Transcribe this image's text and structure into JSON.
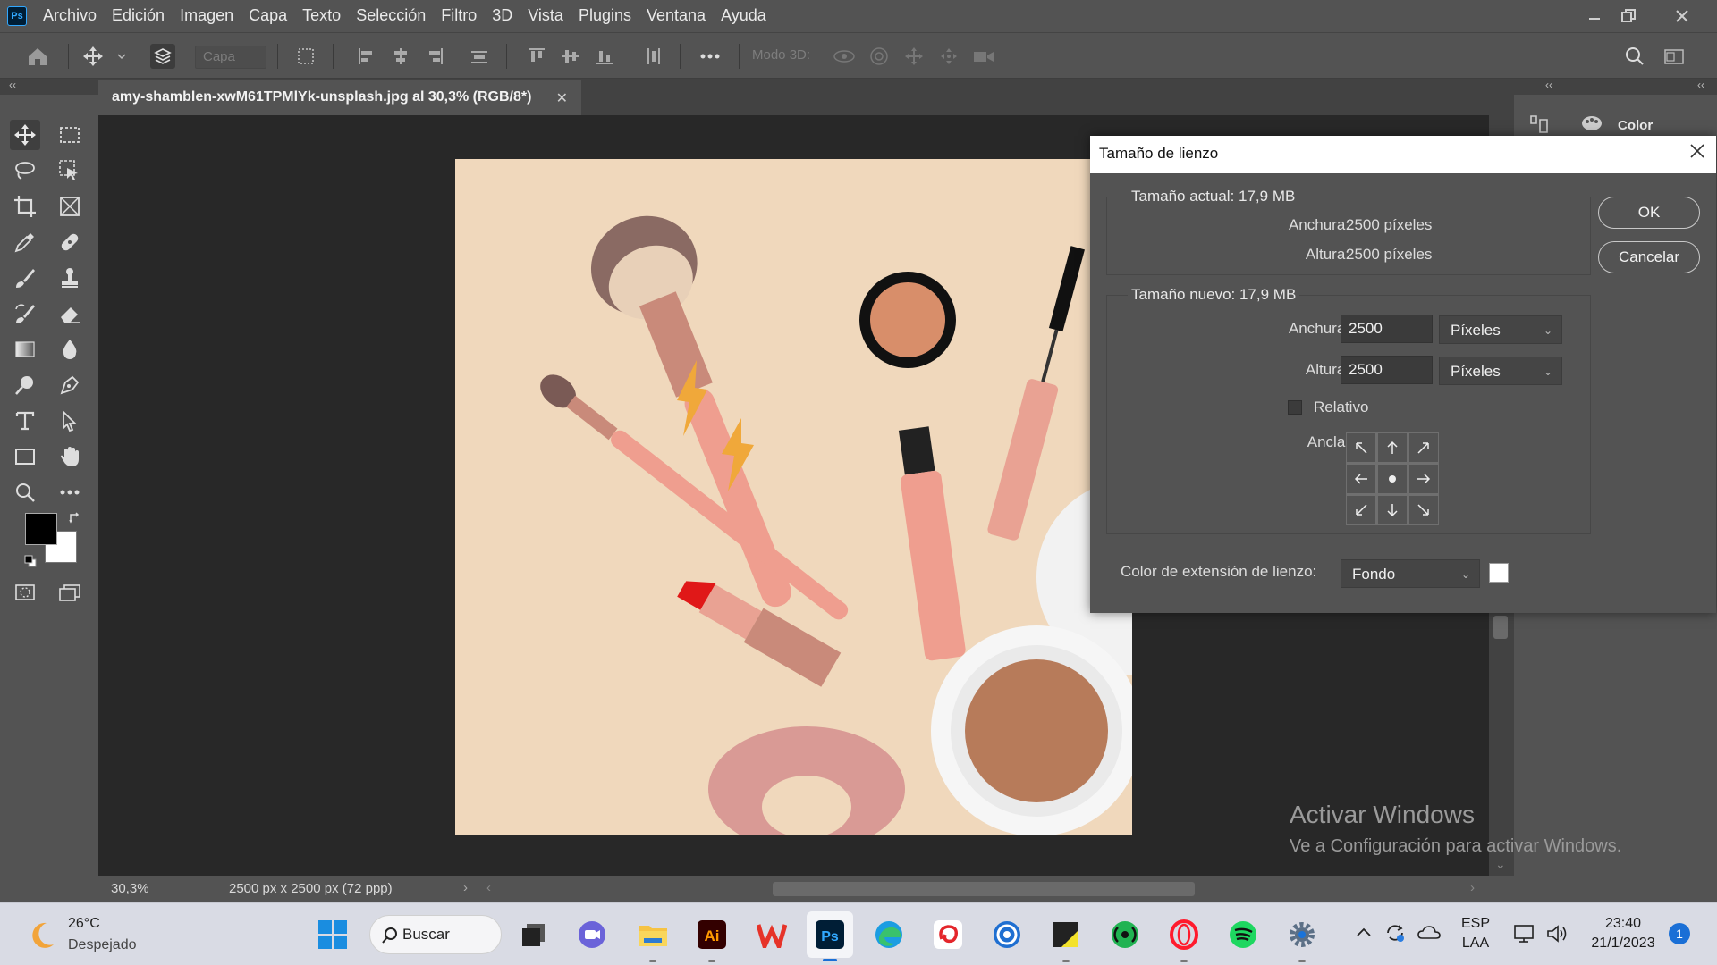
{
  "app": {
    "logo": "Ps"
  },
  "menu": [
    "Archivo",
    "Edición",
    "Imagen",
    "Capa",
    "Texto",
    "Selección",
    "Filtro",
    "3D",
    "Vista",
    "Plugins",
    "Ventana",
    "Ayuda"
  ],
  "options_bar": {
    "layer_select": "Capa",
    "mode3d_label": "Modo 3D:"
  },
  "document": {
    "tab_title": "amy-shamblen-xwM61TPMlYk-unsplash.jpg al 30,3% (RGB/8*)",
    "zoom": "30,3%",
    "doc_info": "2500 px x 2500 px (72 ppp)"
  },
  "right_panel": {
    "color_label": "Color"
  },
  "dialog": {
    "title": "Tamaño de lienzo",
    "current_size_label": "Tamaño actual: 17,9 MB",
    "current_width_label": "Anchura:",
    "current_width_value": "2500 píxeles",
    "current_height_label": "Altura:",
    "current_height_value": "2500 píxeles",
    "new_size_label": "Tamaño nuevo: 17,9 MB",
    "new_width_label": "Anchura:",
    "new_width_value": "2500",
    "new_width_unit": "Píxeles",
    "new_height_label": "Altura:",
    "new_height_value": "2500",
    "new_height_unit": "Píxeles",
    "relative_label": "Relativo",
    "anchor_label": "Ancla:",
    "extension_color_label": "Color de extensión de lienzo:",
    "extension_color_value": "Fondo",
    "extension_swatch_color": "#ffffff",
    "ok_label": "OK",
    "cancel_label": "Cancelar"
  },
  "watermark": {
    "line1": "Activar Windows",
    "line2": "Ve a Configuración para activar Windows."
  },
  "taskbar": {
    "weather_temp": "26°C",
    "weather_desc": "Despejado",
    "search_label": "Buscar",
    "lang_line1": "ESP",
    "lang_line2": "LAA",
    "time": "23:40",
    "date": "21/1/2023",
    "notification_count": "1"
  }
}
